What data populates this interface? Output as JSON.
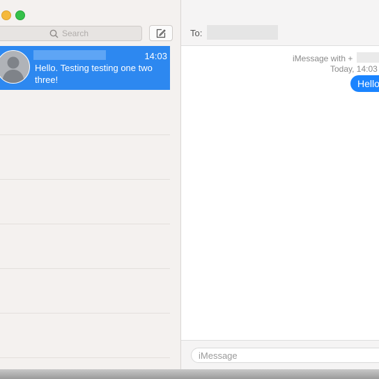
{
  "sidebar": {
    "search": {
      "placeholder": "Search"
    },
    "conversations": [
      {
        "time": "14:03",
        "preview": "Hello. Testing testing one two three!"
      }
    ]
  },
  "chat": {
    "to_label": "To:",
    "meta": {
      "line1": "iMessage with +",
      "line2": "Today, 14:03"
    },
    "messages": [
      {
        "text": "Hello"
      }
    ],
    "input": {
      "placeholder": "iMessage"
    }
  },
  "colors": {
    "accent": "#2d88f0",
    "bubble": "#1a84ff",
    "traffic_minimize": "#f5b93b",
    "traffic_zoom": "#35c14a"
  },
  "icons": [
    "search-icon",
    "compose-icon",
    "avatar-icon"
  ]
}
